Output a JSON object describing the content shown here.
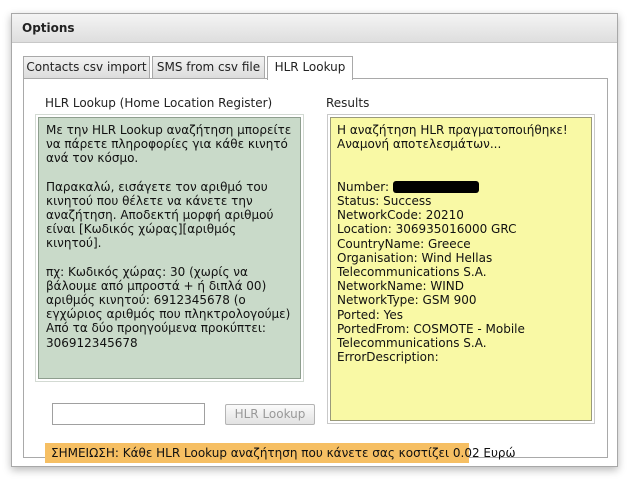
{
  "window": {
    "title": "Options"
  },
  "tabs": [
    {
      "label": "Contacts csv import",
      "active": false
    },
    {
      "label": "SMS from csv file",
      "active": false
    },
    {
      "label": "HLR Lookup",
      "active": true
    }
  ],
  "hlr": {
    "section_label": "HLR Lookup (Home Location Register)",
    "info_paragraphs": [
      "Με την HLR Lookup αναζήτηση μπορείτε να πάρετε πληροφορίες για κάθε κινητό ανά τον κόσμο.",
      "Παρακαλώ, εισάγετε τον αριθμό του κινητού που θέλετε να κάνετε την αναζήτηση. Αποδεκτή μορφή αριθμού είναι [Κωδικός χώρας][αριθμός κινητού].",
      "πχ: Κωδικός χώρας: 30 (χωρίς να βάλουμε από μπροστά + ή διπλά 00) αριθμός κινητού: 6912345678 (ο εγχώριος αριθμός που πληκτρολογούμε) Από τα δύο προηγούμενα προκύπτει: 306912345678"
    ],
    "input_value": "",
    "input_placeholder": "",
    "button_label": "HLR Lookup"
  },
  "results": {
    "section_label": "Results",
    "status_line1": "Η αναζήτηση HLR πραγματοποιήθηκε!",
    "status_line2": "Αναμονή αποτελεσμάτων...",
    "fields": [
      {
        "key": "Number:",
        "value": "",
        "redacted": true
      },
      {
        "key": "Status:",
        "value": "Success"
      },
      {
        "key": "NetworkCode:",
        "value": "20210"
      },
      {
        "key": "Location:",
        "value": "306935016000 GRC"
      },
      {
        "key": "CountryName:",
        "value": "Greece"
      },
      {
        "key": "Organisation:",
        "value": "Wind Hellas Telecommunications S.A."
      },
      {
        "key": "NetworkName:",
        "value": "WIND"
      },
      {
        "key": "NetworkType:",
        "value": "GSM 900"
      },
      {
        "key": "Ported:",
        "value": "Yes"
      },
      {
        "key": "PortedFrom:",
        "value": "COSMOTE - Mobile Telecommunications S.A."
      },
      {
        "key": "ErrorDescription:",
        "value": ""
      }
    ]
  },
  "note": "ΣΗΜΕΙΩΣΗ: Κάθε HLR Lookup αναζήτηση που κάνετε σας κοστίζει 0.02 Ευρώ",
  "colors": {
    "info_background": "#c9dac9",
    "results_background": "#f9f9a5",
    "note_background": "#f6bf63"
  }
}
